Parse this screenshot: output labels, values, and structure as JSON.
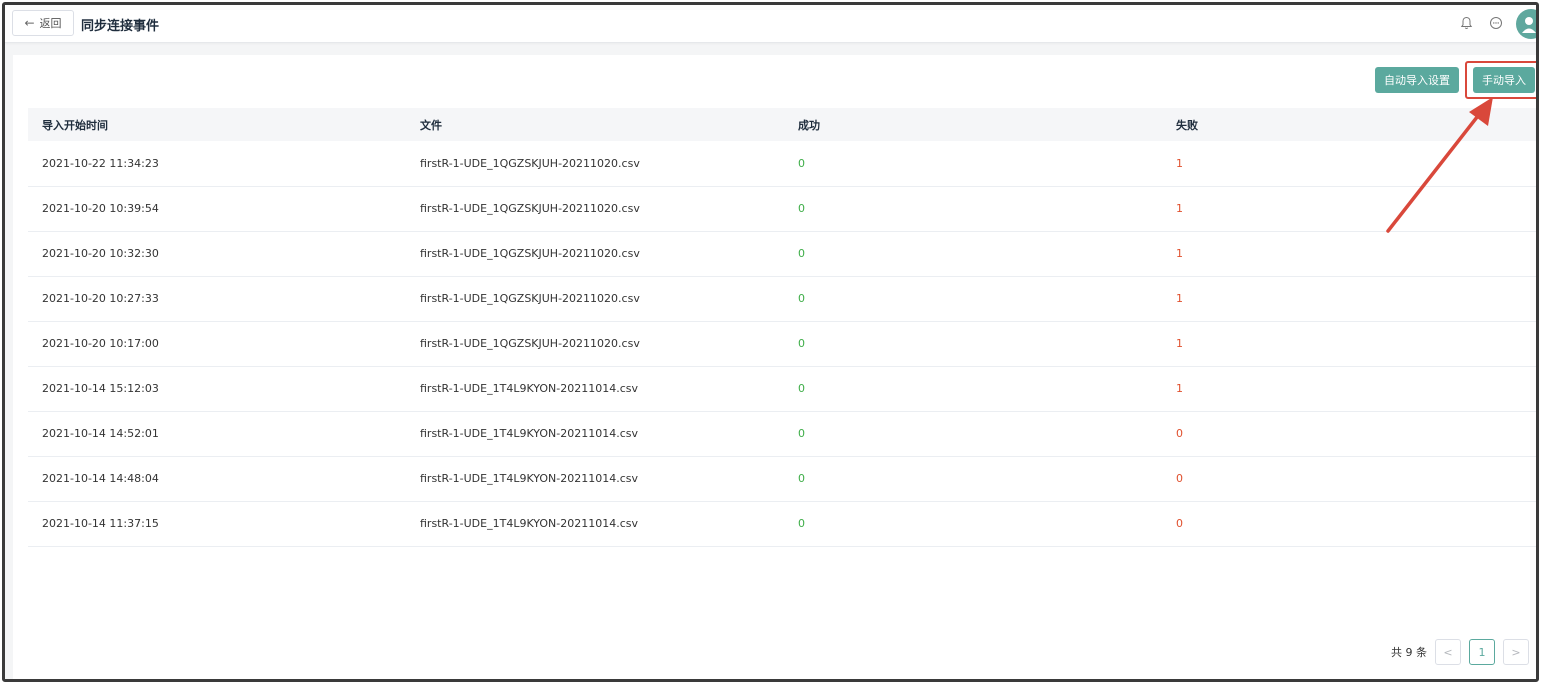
{
  "header": {
    "back_label": "返回",
    "title": "同步连接事件"
  },
  "toolbar": {
    "auto_import_label": "自动导入设置",
    "manual_import_label": "手动导入"
  },
  "table": {
    "columns": [
      "导入开始时间",
      "文件",
      "成功",
      "失败"
    ],
    "rows": [
      {
        "time": "2021-10-22 11:34:23",
        "file": "firstR-1-UDE_1QGZSKJUH-20211020.csv",
        "success": "0",
        "fail": "1"
      },
      {
        "time": "2021-10-20 10:39:54",
        "file": "firstR-1-UDE_1QGZSKJUH-20211020.csv",
        "success": "0",
        "fail": "1"
      },
      {
        "time": "2021-10-20 10:32:30",
        "file": "firstR-1-UDE_1QGZSKJUH-20211020.csv",
        "success": "0",
        "fail": "1"
      },
      {
        "time": "2021-10-20 10:27:33",
        "file": "firstR-1-UDE_1QGZSKJUH-20211020.csv",
        "success": "0",
        "fail": "1"
      },
      {
        "time": "2021-10-20 10:17:00",
        "file": "firstR-1-UDE_1QGZSKJUH-20211020.csv",
        "success": "0",
        "fail": "1"
      },
      {
        "time": "2021-10-14 15:12:03",
        "file": "firstR-1-UDE_1T4L9KYON-20211014.csv",
        "success": "0",
        "fail": "1"
      },
      {
        "time": "2021-10-14 14:52:01",
        "file": "firstR-1-UDE_1T4L9KYON-20211014.csv",
        "success": "0",
        "fail": "0"
      },
      {
        "time": "2021-10-14 14:48:04",
        "file": "firstR-1-UDE_1T4L9KYON-20211014.csv",
        "success": "0",
        "fail": "0"
      },
      {
        "time": "2021-10-14 11:37:15",
        "file": "firstR-1-UDE_1T4L9KYON-20211014.csv",
        "success": "0",
        "fail": "0"
      }
    ]
  },
  "pagination": {
    "total_label": "共 9 条",
    "prev_icon": "chevron-left-icon",
    "next_icon": "chevron-right-icon",
    "current_page": "1"
  },
  "icons": {
    "back": "arrow-left-icon",
    "notification": "bell-icon",
    "messages": "chat-bubble-icon",
    "avatar": "user-avatar"
  },
  "colors": {
    "accent": "#5ba99e",
    "success": "#3fae49",
    "failure": "#e0502e",
    "annotation": "#d9483b"
  }
}
